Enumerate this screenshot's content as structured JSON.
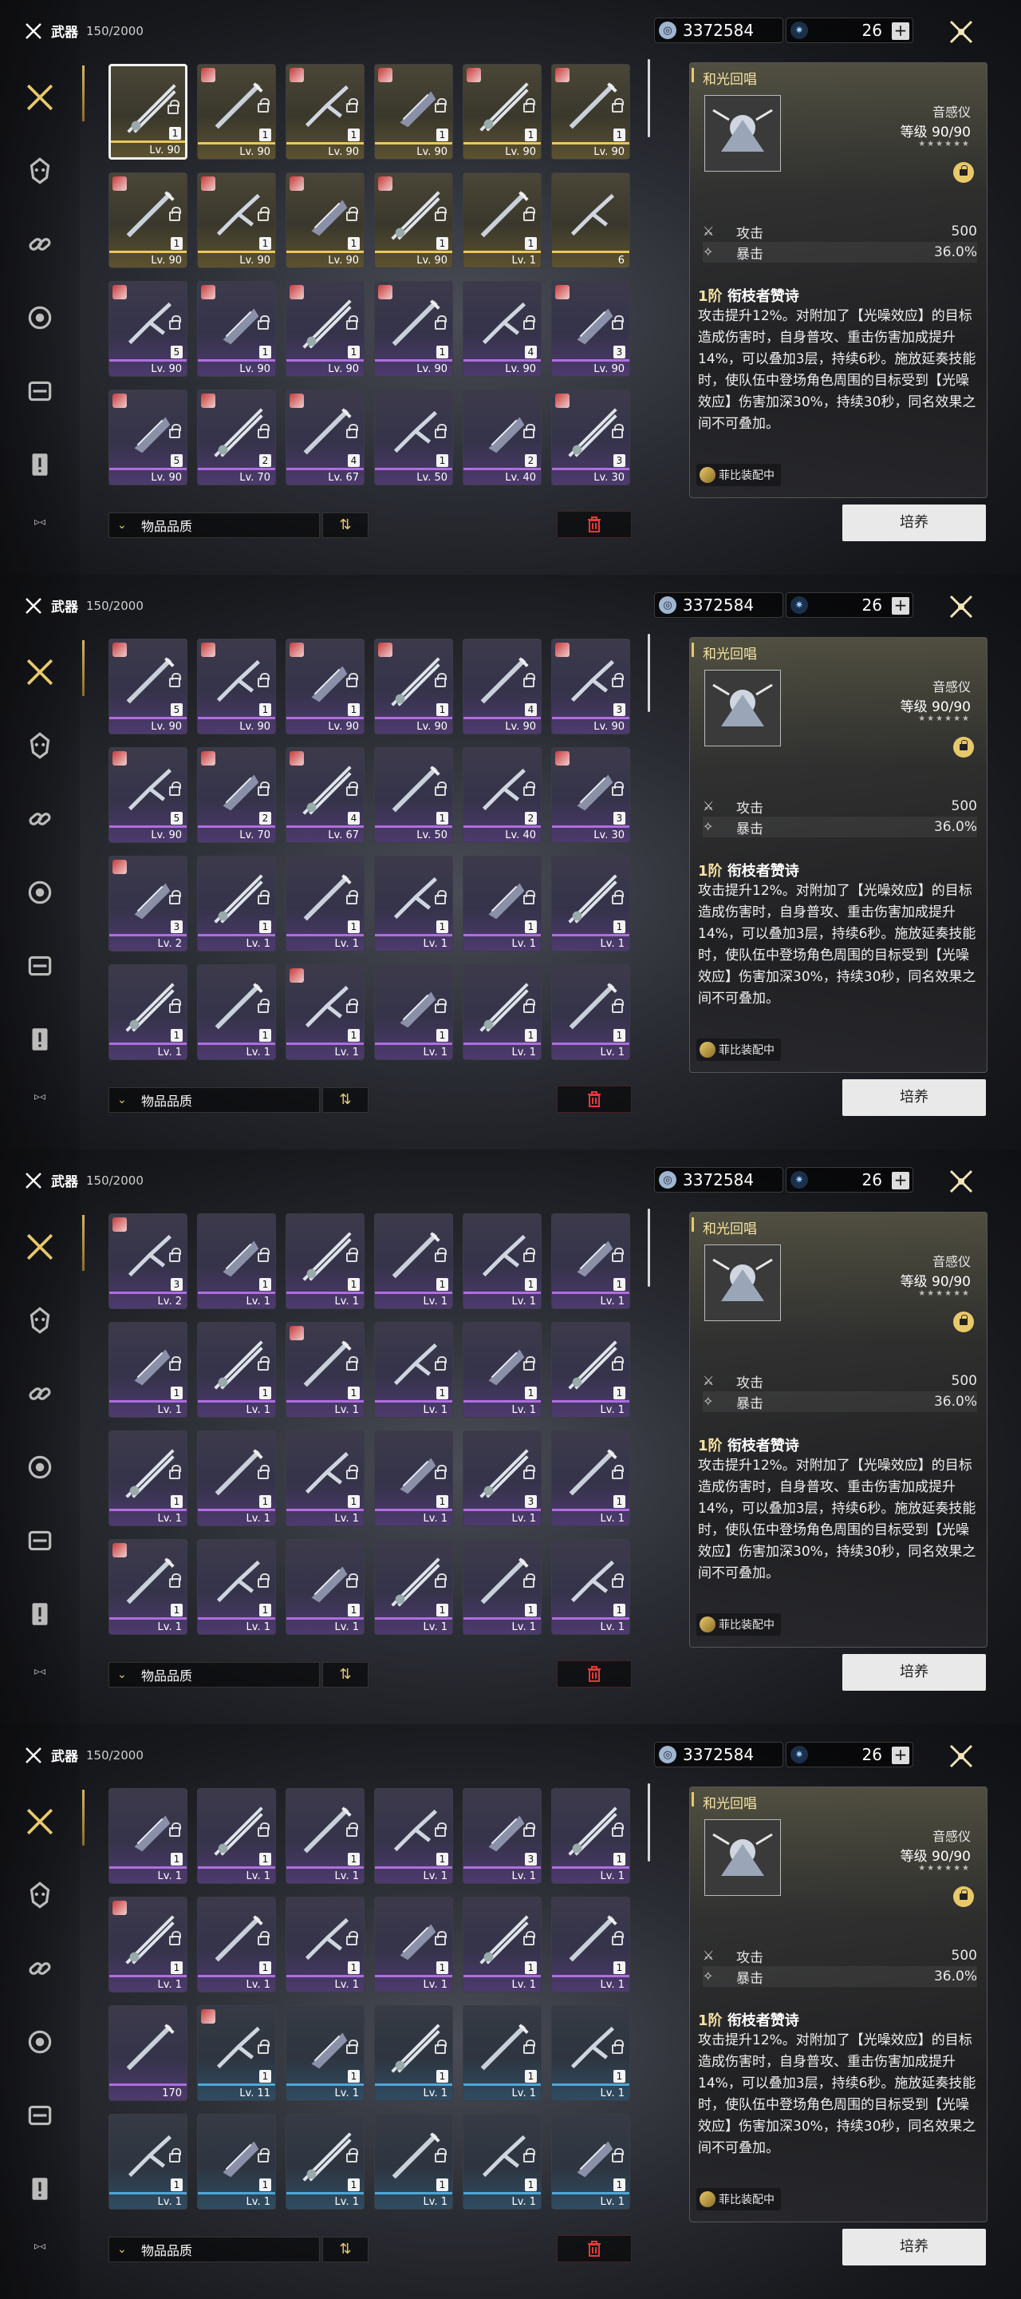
{
  "header": {
    "title": "武器",
    "count": "150/2000"
  },
  "currency": {
    "coins": "3372584",
    "stamina": "26"
  },
  "sort_icon": "⇅",
  "filter": {
    "label": "物品品质"
  },
  "detail": {
    "name": "和光回唱",
    "type": "音感仪",
    "level": "等级 90/90",
    "stars": "★★★★★★",
    "attack_label": "攻击",
    "attack_value": "500",
    "crit_label": "暴击",
    "crit_value": "36.0%",
    "passive_rank": "1阶",
    "passive_name": "衔枝者赞诗",
    "passive_desc": "攻击提升12%。对附加了【光噪效应】的目标造成伤害时，自身普攻、重击伤害加成提升14%，可以叠加3层，持续6秒。施放延奏技能时，使队伍中登场角色周围的目标受到【光噪效应】伤害加深30%，持续30秒，同名效果之间不可叠加。",
    "equipped_by": "菲比装配中",
    "cultivate_button": "培养"
  },
  "sidebar_icons": [
    "weapon-icon",
    "echo-icon",
    "upgrade-material-icon",
    "develop-material-icon",
    "resource-icon",
    "quest-item-icon"
  ],
  "screens": [
    {
      "rows": [
        [
          {
            "q": "q5",
            "lv": "Lv. 90",
            "c": "1",
            "sel": true,
            "lk": true
          },
          {
            "q": "q5",
            "lv": "Lv. 90",
            "c": "1",
            "av": true,
            "lk": true
          },
          {
            "q": "q5",
            "lv": "Lv. 90",
            "c": "1",
            "av": true,
            "lk": true
          },
          {
            "q": "q5",
            "lv": "Lv. 90",
            "c": "1",
            "av": true,
            "lk": true
          },
          {
            "q": "q5",
            "lv": "Lv. 90",
            "c": "1",
            "av": true,
            "lk": true
          },
          {
            "q": "q5",
            "lv": "Lv. 90",
            "c": "1",
            "av": true,
            "lk": true
          }
        ],
        [
          {
            "q": "q5",
            "lv": "Lv. 90",
            "c": "1",
            "av": true,
            "lk": true
          },
          {
            "q": "q5",
            "lv": "Lv. 90",
            "c": "1",
            "av": true,
            "lk": true
          },
          {
            "q": "q5",
            "lv": "Lv. 90",
            "c": "1",
            "av": true,
            "lk": true
          },
          {
            "q": "q5",
            "lv": "Lv. 90",
            "c": "1",
            "av": true,
            "lk": true
          },
          {
            "q": "q5",
            "lv": "Lv. 1",
            "c": "1",
            "lk": true
          },
          {
            "q": "q5",
            "lv": "6",
            "c": "",
            "lk": false
          }
        ],
        [
          {
            "q": "q4",
            "lv": "Lv. 90",
            "c": "5",
            "av": true,
            "lk": true
          },
          {
            "q": "q4",
            "lv": "Lv. 90",
            "c": "1",
            "av": true,
            "lk": true
          },
          {
            "q": "q4",
            "lv": "Lv. 90",
            "c": "1",
            "av": true,
            "lk": true
          },
          {
            "q": "q4",
            "lv": "Lv. 90",
            "c": "1",
            "av": true,
            "lk": true
          },
          {
            "q": "q4",
            "lv": "Lv. 90",
            "c": "4",
            "lk": true
          },
          {
            "q": "q4",
            "lv": "Lv. 90",
            "c": "3",
            "av": true,
            "lk": true
          }
        ],
        [
          {
            "q": "q4",
            "lv": "Lv. 90",
            "c": "5",
            "av": true,
            "lk": true
          },
          {
            "q": "q4",
            "lv": "Lv. 70",
            "c": "2",
            "av": true,
            "lk": true
          },
          {
            "q": "q4",
            "lv": "Lv. 67",
            "c": "4",
            "av": true,
            "lk": true
          },
          {
            "q": "q4",
            "lv": "Lv. 50",
            "c": "1",
            "lk": true
          },
          {
            "q": "q4",
            "lv": "Lv. 40",
            "c": "2",
            "lk": true
          },
          {
            "q": "q4",
            "lv": "Lv. 30",
            "c": "3",
            "av": true,
            "lk": true
          }
        ]
      ]
    },
    {
      "rows": [
        [
          {
            "q": "q4",
            "lv": "Lv. 90",
            "c": "5",
            "av": true,
            "lk": true
          },
          {
            "q": "q4",
            "lv": "Lv. 90",
            "c": "1",
            "av": true,
            "lk": true
          },
          {
            "q": "q4",
            "lv": "Lv. 90",
            "c": "1",
            "av": true,
            "lk": true
          },
          {
            "q": "q4",
            "lv": "Lv. 90",
            "c": "1",
            "av": true,
            "lk": true
          },
          {
            "q": "q4",
            "lv": "Lv. 90",
            "c": "4",
            "lk": true
          },
          {
            "q": "q4",
            "lv": "Lv. 90",
            "c": "3",
            "av": true,
            "lk": true
          }
        ],
        [
          {
            "q": "q4",
            "lv": "Lv. 90",
            "c": "5",
            "av": true,
            "lk": true
          },
          {
            "q": "q4",
            "lv": "Lv. 70",
            "c": "2",
            "av": true,
            "lk": true
          },
          {
            "q": "q4",
            "lv": "Lv. 67",
            "c": "4",
            "av": true,
            "lk": true
          },
          {
            "q": "q4",
            "lv": "Lv. 50",
            "c": "1",
            "lk": true
          },
          {
            "q": "q4",
            "lv": "Lv. 40",
            "c": "2",
            "lk": true
          },
          {
            "q": "q4",
            "lv": "Lv. 30",
            "c": "3",
            "av": true,
            "lk": true
          }
        ],
        [
          {
            "q": "q4",
            "lv": "Lv. 2",
            "c": "3",
            "av": true,
            "lk": true
          },
          {
            "q": "q4",
            "lv": "Lv. 1",
            "c": "1",
            "lk": true
          },
          {
            "q": "q4",
            "lv": "Lv. 1",
            "c": "1",
            "lk": true
          },
          {
            "q": "q4",
            "lv": "Lv. 1",
            "c": "1",
            "lk": true
          },
          {
            "q": "q4",
            "lv": "Lv. 1",
            "c": "1",
            "lk": true
          },
          {
            "q": "q4",
            "lv": "Lv. 1",
            "c": "1",
            "lk": true
          }
        ],
        [
          {
            "q": "q4",
            "lv": "Lv. 1",
            "c": "1",
            "lk": true
          },
          {
            "q": "q4",
            "lv": "Lv. 1",
            "c": "1",
            "lk": true
          },
          {
            "q": "q4",
            "lv": "Lv. 1",
            "c": "1",
            "av": true,
            "lk": true
          },
          {
            "q": "q4",
            "lv": "Lv. 1",
            "c": "1",
            "lk": true
          },
          {
            "q": "q4",
            "lv": "Lv. 1",
            "c": "1",
            "lk": true
          },
          {
            "q": "q4",
            "lv": "Lv. 1",
            "c": "1",
            "lk": true
          }
        ]
      ]
    },
    {
      "rows": [
        [
          {
            "q": "q4",
            "lv": "Lv. 2",
            "c": "3",
            "av": true,
            "lk": true
          },
          {
            "q": "q4",
            "lv": "Lv. 1",
            "c": "1",
            "lk": true
          },
          {
            "q": "q4",
            "lv": "Lv. 1",
            "c": "1",
            "lk": true
          },
          {
            "q": "q4",
            "lv": "Lv. 1",
            "c": "1",
            "lk": true
          },
          {
            "q": "q4",
            "lv": "Lv. 1",
            "c": "1",
            "lk": true
          },
          {
            "q": "q4",
            "lv": "Lv. 1",
            "c": "1",
            "lk": true
          }
        ],
        [
          {
            "q": "q4",
            "lv": "Lv. 1",
            "c": "1",
            "lk": true
          },
          {
            "q": "q4",
            "lv": "Lv. 1",
            "c": "1",
            "lk": true
          },
          {
            "q": "q4",
            "lv": "Lv. 1",
            "c": "1",
            "av": true,
            "lk": true
          },
          {
            "q": "q4",
            "lv": "Lv. 1",
            "c": "1",
            "lk": true
          },
          {
            "q": "q4",
            "lv": "Lv. 1",
            "c": "1",
            "lk": true
          },
          {
            "q": "q4",
            "lv": "Lv. 1",
            "c": "1",
            "lk": true
          }
        ],
        [
          {
            "q": "q4",
            "lv": "Lv. 1",
            "c": "1",
            "lk": true
          },
          {
            "q": "q4",
            "lv": "Lv. 1",
            "c": "1",
            "lk": true
          },
          {
            "q": "q4",
            "lv": "Lv. 1",
            "c": "1",
            "lk": true
          },
          {
            "q": "q4",
            "lv": "Lv. 1",
            "c": "1",
            "lk": true
          },
          {
            "q": "q4",
            "lv": "Lv. 1",
            "c": "3",
            "lk": true
          },
          {
            "q": "q4",
            "lv": "Lv. 1",
            "c": "1",
            "lk": true
          }
        ],
        [
          {
            "q": "q4",
            "lv": "Lv. 1",
            "c": "1",
            "av": true,
            "lk": true
          },
          {
            "q": "q4",
            "lv": "Lv. 1",
            "c": "1",
            "lk": true
          },
          {
            "q": "q4",
            "lv": "Lv. 1",
            "c": "1",
            "lk": true
          },
          {
            "q": "q4",
            "lv": "Lv. 1",
            "c": "1",
            "lk": true
          },
          {
            "q": "q4",
            "lv": "Lv. 1",
            "c": "1",
            "lk": true
          },
          {
            "q": "q4",
            "lv": "Lv. 1",
            "c": "1",
            "lk": true
          }
        ]
      ]
    },
    {
      "rows": [
        [
          {
            "q": "q4",
            "lv": "Lv. 1",
            "c": "1",
            "lk": true
          },
          {
            "q": "q4",
            "lv": "Lv. 1",
            "c": "1",
            "lk": true
          },
          {
            "q": "q4",
            "lv": "Lv. 1",
            "c": "1",
            "lk": true
          },
          {
            "q": "q4",
            "lv": "Lv. 1",
            "c": "1",
            "lk": true
          },
          {
            "q": "q4",
            "lv": "Lv. 1",
            "c": "3",
            "lk": true
          },
          {
            "q": "q4",
            "lv": "Lv. 1",
            "c": "1",
            "lk": true
          }
        ],
        [
          {
            "q": "q4",
            "lv": "Lv. 1",
            "c": "1",
            "av": true,
            "lk": true
          },
          {
            "q": "q4",
            "lv": "Lv. 1",
            "c": "1",
            "lk": true
          },
          {
            "q": "q4",
            "lv": "Lv. 1",
            "c": "1",
            "lk": true
          },
          {
            "q": "q4",
            "lv": "Lv. 1",
            "c": "1",
            "lk": true
          },
          {
            "q": "q4",
            "lv": "Lv. 1",
            "c": "1",
            "lk": true
          },
          {
            "q": "q4",
            "lv": "Lv. 1",
            "c": "1",
            "lk": true
          }
        ],
        [
          {
            "q": "q4",
            "lv": "170",
            "c": "",
            "lk": false
          },
          {
            "q": "q3",
            "lv": "Lv. 11",
            "c": "1",
            "av": true,
            "lk": true
          },
          {
            "q": "q3",
            "lv": "Lv. 1",
            "c": "1",
            "lk": true
          },
          {
            "q": "q3",
            "lv": "Lv. 1",
            "c": "1",
            "lk": true
          },
          {
            "q": "q3",
            "lv": "Lv. 1",
            "c": "1",
            "lk": true
          },
          {
            "q": "q3",
            "lv": "Lv. 1",
            "c": "1",
            "lk": true
          }
        ],
        [
          {
            "q": "q3",
            "lv": "Lv. 1",
            "c": "1",
            "lk": true
          },
          {
            "q": "q3",
            "lv": "Lv. 1",
            "c": "1",
            "lk": true
          },
          {
            "q": "q3",
            "lv": "Lv. 1",
            "c": "1",
            "lk": true
          },
          {
            "q": "q3",
            "lv": "Lv. 1",
            "c": "1",
            "lk": true
          },
          {
            "q": "q3",
            "lv": "Lv. 1",
            "c": "1",
            "lk": true
          },
          {
            "q": "q3",
            "lv": "Lv. 1",
            "c": "1",
            "lk": true
          }
        ]
      ]
    }
  ]
}
